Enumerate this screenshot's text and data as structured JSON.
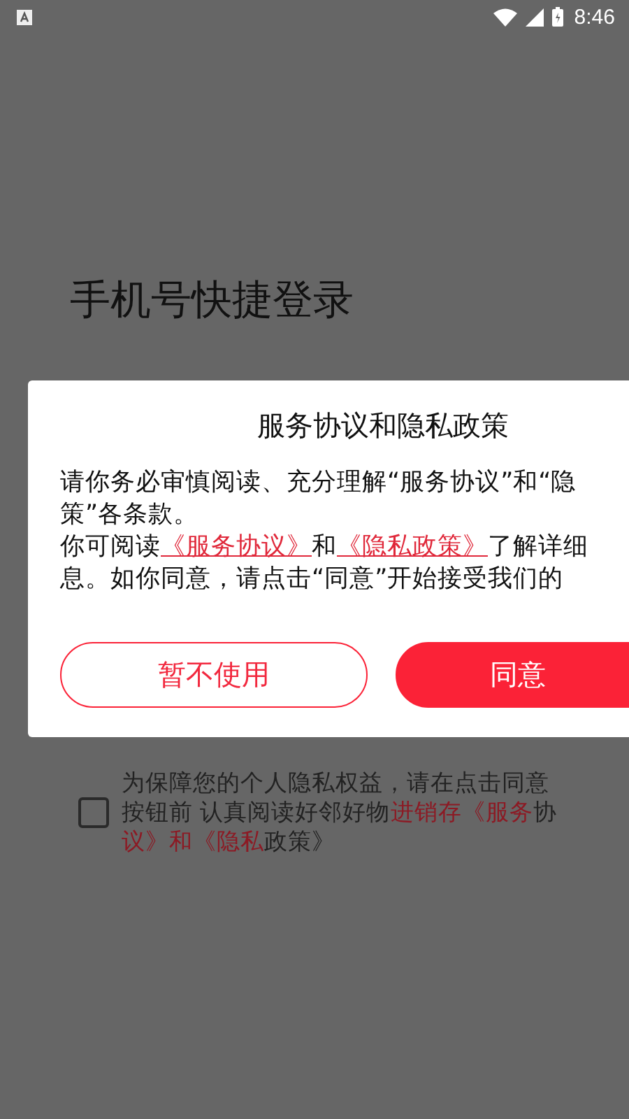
{
  "status_bar": {
    "time": "8:46"
  },
  "page": {
    "title": "手机号快捷登录"
  },
  "dialog": {
    "title": "服务协议和隐私政策",
    "lines": [
      [
        {
          "text": "请你务必审慎阅读、充分理解“服务协议”和“隐",
          "link": false
        }
      ],
      [
        {
          "text": "策”各条款。",
          "link": false
        }
      ],
      [
        {
          "text": "你可阅读",
          "link": false
        },
        {
          "text": "《服务协议》",
          "link": true
        },
        {
          "text": "和",
          "link": false
        },
        {
          "text": "《隐私政策》",
          "link": true
        },
        {
          "text": "了解详细",
          "link": false
        }
      ],
      [
        {
          "text": "息。如你同意，请点击“同意”开始接受我们的",
          "link": false
        }
      ]
    ],
    "buttons": [
      {
        "label": "暂不使用",
        "kind": "secondary"
      },
      {
        "label": "同意",
        "kind": "primary"
      }
    ]
  },
  "consent": {
    "checked": false,
    "segments": [
      {
        "text": "为保障您的个人隐私权益，请在点击同意按钮前 认真阅读好邻好物",
        "highlight": false
      },
      {
        "text": "进销存《服务",
        "highlight": true
      },
      {
        "text": "协",
        "highlight": false
      },
      {
        "text": "议》和《隐私",
        "highlight": true
      },
      {
        "text": "政策》",
        "highlight": false
      }
    ]
  }
}
